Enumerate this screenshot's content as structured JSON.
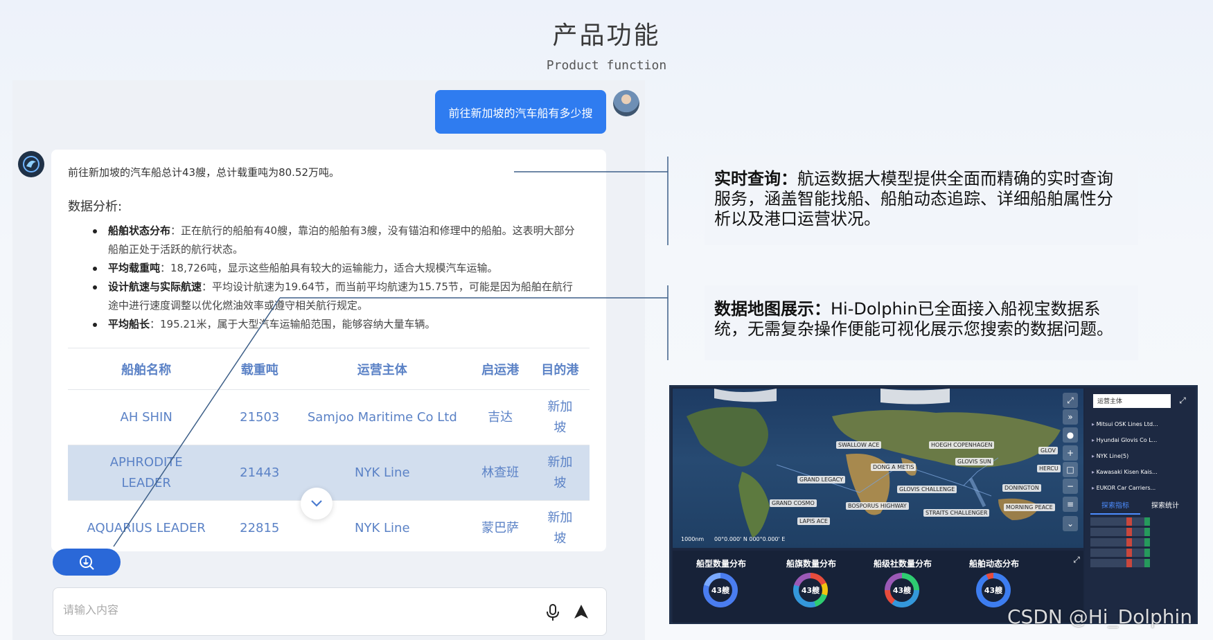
{
  "header": {
    "title": "产品功能",
    "subtitle": "Product function"
  },
  "chat": {
    "user_message": "前往新加坡的汽车船有多少搜",
    "answer": {
      "summary": "前往新加坡的汽车船总计43艘，总计载重吨为80.52万吨。",
      "analysis_title": "数据分析:",
      "bullets": [
        {
          "label": "船舶状态分布",
          "text": "：正在航行的船舶有40艘，靠泊的船舶有3艘，没有锚泊和修理中的船舶。这表明大部分船舶正处于活跃的航行状态。"
        },
        {
          "label": "平均载重吨",
          "text": "：18,726吨，显示这些船舶具有较大的运输能力，适合大规模汽车运输。"
        },
        {
          "label": "设计航速与实际航速",
          "text": "：平均设计航速为19.64节，而当前平均航速为15.75节，可能是因为船舶在航行途中进行速度调整以优化燃油效率或遵守相关航行规定。"
        },
        {
          "label": "平均船长",
          "text": "：195.21米，属于大型汽车运输船范围，能够容纳大量车辆。"
        }
      ],
      "table": {
        "headers": [
          "船舶名称",
          "载重吨",
          "运营主体",
          "启运港",
          "目的港"
        ],
        "rows": [
          [
            "AH SHIN",
            "21503",
            "Samjoo Maritime Co Ltd",
            "吉达",
            "新加坡"
          ],
          [
            "APHRODITE LEADER",
            "21443",
            "NYK Line",
            "林查班",
            "新加坡"
          ],
          [
            "AQUARIUS LEADER",
            "22815",
            "NYK Line",
            "蒙巴萨",
            "新加坡"
          ]
        ]
      }
    },
    "input_placeholder": "请输入内容",
    "icons": {
      "scroll": "chevron-down-icon",
      "tool": "ship-search-icon",
      "mic": "microphone-icon",
      "send": "send-icon"
    }
  },
  "features": [
    {
      "label": "实时查询：",
      "text": "航运数据大模型提供全面而精确的实时查询服务，涵盖智能找船、船舶动态追踪、详细船舶属性分析以及港口运营状况。"
    },
    {
      "label": "数据地图展示：",
      "text": "Hi-Dolphin已全面接入船视宝数据系统，无需复杂操作便能可视化展示您搜索的数据问题。"
    }
  ],
  "dashboard": {
    "map_labels": [
      "SWALLOW ACE",
      "HOEGH COPENHAGEN",
      "DONG A METIS",
      "GLOVIS SUN",
      "GRAND LEGACY",
      "GLOVIS CHALLENGE",
      "DONINGTON",
      "GRAND COSMO",
      "BOSPORUS HIGHWAY",
      "MORNING PEACE",
      "STRAITS CHALLENGER",
      "LAPIS ACE",
      "HERCU",
      "GLOV"
    ],
    "scale": "1000nm",
    "coords": "00°0.000' N 000°0.000' E",
    "stats": [
      {
        "title": "船型数量分布",
        "value": "43艘"
      },
      {
        "title": "船旗数量分布",
        "value": "43艘"
      },
      {
        "title": "船级社数量分布",
        "value": "43艘"
      },
      {
        "title": "船舶动态分布",
        "value": "43艘"
      }
    ],
    "side": {
      "search_value": "运营主体",
      "operators": [
        "Mitsui OSK Lines Ltd...",
        "Hyundai Glovis Co L...",
        "NYK Line(5)",
        "Kawasaki Kisen Kais...",
        "EUKOR Car Carriers..."
      ],
      "tabs": [
        "探索指标",
        "探索统计"
      ]
    }
  },
  "watermark": "CSDN @Hi_Dolphin",
  "colors": {
    "accent": "#2f7cf0",
    "table_text": "#5b82c6",
    "dashboard_bg": "#1b2740"
  }
}
